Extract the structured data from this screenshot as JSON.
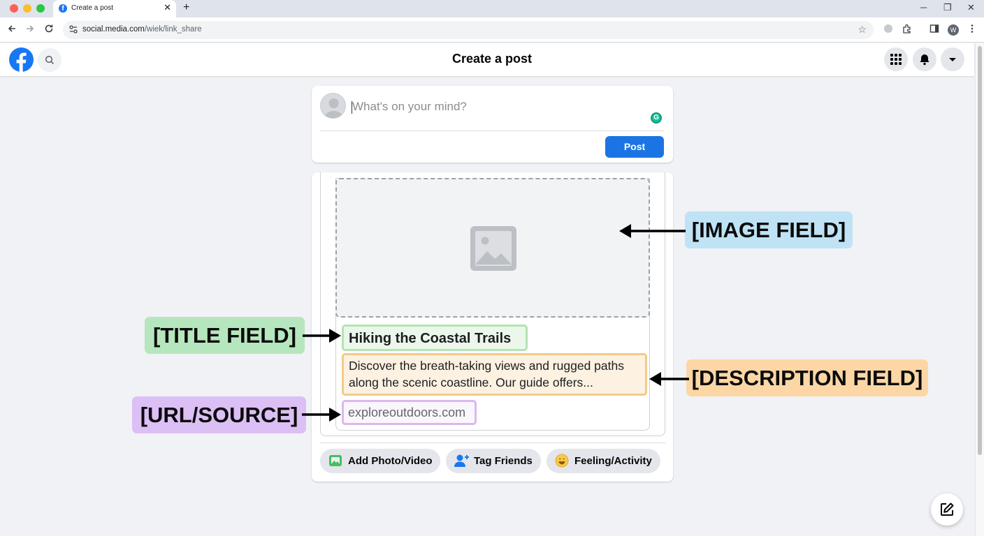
{
  "browser": {
    "tab_title": "Create a post",
    "tab_close": "✕",
    "new_tab": "+",
    "url_host": "social.media.com",
    "url_path": "/wiek/link_share",
    "profile_initial": "W",
    "window_minimize": "─",
    "window_restore": "❐",
    "window_close": "✕"
  },
  "nav": {
    "title": "Create a post"
  },
  "composer": {
    "placeholder": "What's on your mind?",
    "grammarly_letter": "G",
    "post_label": "Post"
  },
  "preview": {
    "title": "Hiking the Coastal Trails",
    "description": "Discover the breath-taking views and rugged paths along the scenic coastline. Our guide offers...",
    "url": "exploreoutdoors.com"
  },
  "actions": [
    {
      "label": "Add Photo/Video",
      "icon": "photo-video-icon"
    },
    {
      "label": "Tag Friends",
      "icon": "tag-friends-icon"
    },
    {
      "label": "Feeling/Activity",
      "icon": "feeling-icon"
    }
  ],
  "annotations": {
    "image": "[IMAGE FIELD]",
    "title": "[TITLE FIELD]",
    "description": "[DESCRIPTION FIELD]",
    "url": "[URL/SOURCE]"
  },
  "colors": {
    "brand_blue": "#1877f2",
    "post_button": "#1b74e4",
    "page_background": "#f0f2f5",
    "image_label": "#bfe3f4",
    "title_label": "#b6e6bd",
    "description_label": "#fcd7a5",
    "url_label": "#dcbff5"
  }
}
